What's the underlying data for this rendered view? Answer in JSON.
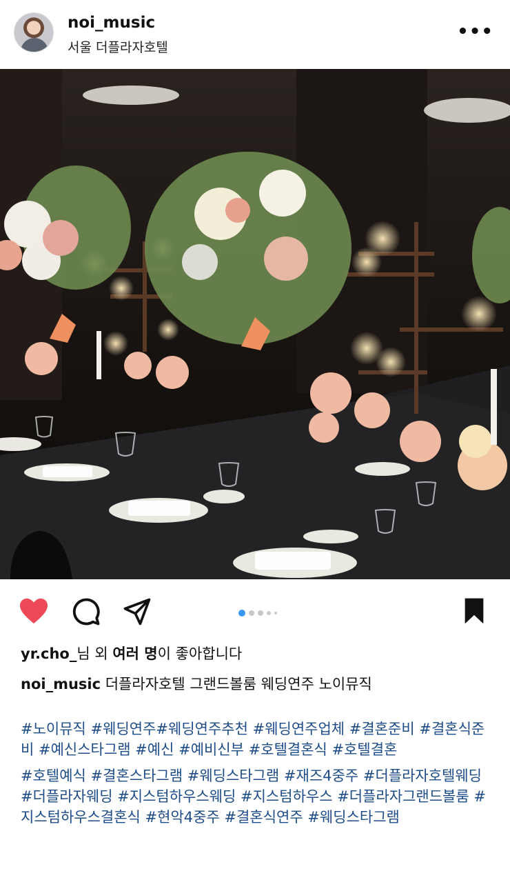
{
  "post": {
    "username": "noi_music",
    "location": "서울 더플라자호텔",
    "more_label": "•••"
  },
  "likes": {
    "liker": "yr.cho_",
    "mid": "님 외 ",
    "others": "여러 명",
    "suffix": "이 좋아합니다"
  },
  "caption": {
    "username": "noi_music",
    "text": " 더플라자호텔 그랜드볼룸 웨딩연주 노이뮤직"
  },
  "hashtags": {
    "para1": "#노이뮤직 #웨딩연주#웨딩연주추천  #웨딩연주업체 #결혼준비 #결혼식준비 #예신스타그램 #예신 #예비신부 #호텔결혼식 #호텔결혼",
    "para2": "#호텔예식 #결혼스타그램 #웨딩스타그램 #재즈4중주 #더플라자호텔웨딩 #더플라자웨딩 #지스텀하우스웨딩 #지스텀하우스 #더플라자그랜드볼룸 #지스텀하우스결혼식 #현악4중주 #결혼식연주 #웨딩스타그램"
  },
  "carousel": {
    "current": 1,
    "visible_dots": 5
  },
  "colors": {
    "heart": "#ed4956",
    "hashtag": "#1d4c89",
    "active_dot": "#3897f0"
  }
}
